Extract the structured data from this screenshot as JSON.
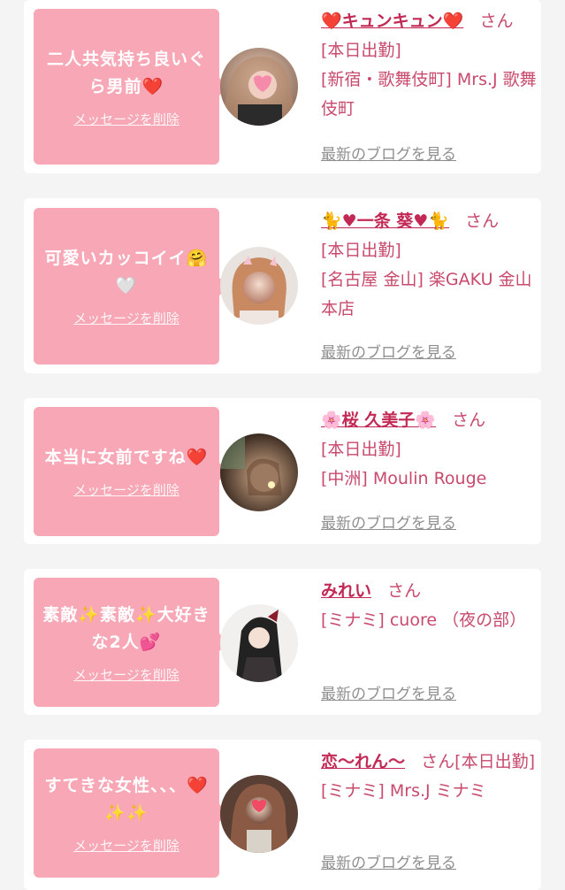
{
  "cards": [
    {
      "message": "二人共気持ち良いぐら男前❤️",
      "delete_label": "メッセージを削除",
      "name": "❤️キュンキュン❤️",
      "honorific": "さん",
      "status": "[本日出勤]",
      "shop": "[新宿・歌舞伎町] Mrs.J 歌舞伎町",
      "blog_link": "最新のブログを見る"
    },
    {
      "message": "可愛いカッコイイ🤗🤍",
      "delete_label": "メッセージを削除",
      "name": "🐈♥一条 葵♥🐈",
      "honorific": "さん",
      "status": "[本日出勤]",
      "shop": "[名古屋 金山] 楽GAKU 金山本店",
      "blog_link": "最新のブログを見る"
    },
    {
      "message": "本当に女前ですね❤️",
      "delete_label": "メッセージを削除",
      "name": "🌸桜 久美子🌸",
      "honorific": "さん",
      "status": "[本日出勤]",
      "shop": "[中洲] Moulin Rouge",
      "blog_link": "最新のブログを見る"
    },
    {
      "message": "素敵✨素敵✨大好きな2人💕",
      "delete_label": "メッセージを削除",
      "name": "みれい",
      "honorific": "さん",
      "status": "",
      "shop": "[ミナミ] cuore （夜の部）",
      "blog_link": "最新のブログを見る"
    },
    {
      "message": "すてきな女性、、、❤️✨✨",
      "delete_label": "メッセージを削除",
      "name": "恋〜れん〜",
      "honorific": "さん",
      "status": "[本日出勤]",
      "shop": "[ミナミ] Mrs.J ミナミ",
      "blog_link": "最新のブログを見る"
    }
  ],
  "colors": {
    "bubble": "#f7a7b5",
    "name": "#c22a55",
    "text": "#c84a6d",
    "link": "#8f8f8f",
    "background": "#f4f4f4"
  }
}
